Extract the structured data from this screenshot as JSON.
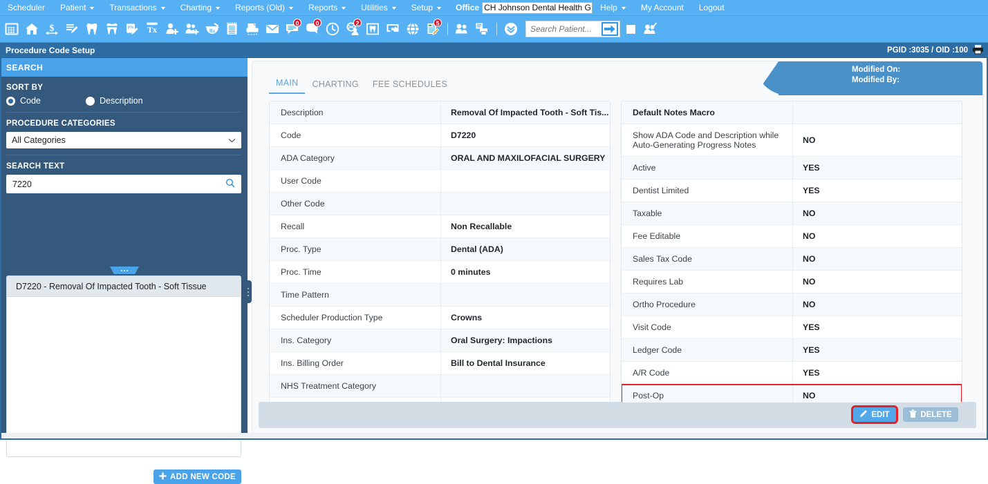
{
  "menubar": {
    "items": [
      {
        "label": "Scheduler",
        "caret": false
      },
      {
        "label": "Patient",
        "caret": true
      },
      {
        "label": "Transactions",
        "caret": true
      },
      {
        "label": "Charting",
        "caret": true
      },
      {
        "label": "Reports (Old)",
        "caret": true
      },
      {
        "label": "Reports",
        "caret": true
      },
      {
        "label": "Utilities",
        "caret": true
      },
      {
        "label": "Setup",
        "caret": true
      }
    ],
    "office_label": "Office",
    "office_value": "CH Johnson Dental Health Ger",
    "right_items": [
      {
        "label": "Help",
        "caret": true
      },
      {
        "label": "My Account",
        "caret": false
      },
      {
        "label": "Logout",
        "caret": false
      }
    ]
  },
  "toolbar": {
    "icons": [
      {
        "name": "calendar-icon",
        "badge": null
      },
      {
        "name": "home-icon",
        "badge": null
      },
      {
        "name": "dollar-transfer-icon",
        "badge": null
      },
      {
        "name": "treatment-plan-icon",
        "badge": null
      },
      {
        "name": "tooth-icon",
        "badge": null
      },
      {
        "name": "perio-tooth-icon",
        "badge": null
      },
      {
        "name": "progress-notes-icon",
        "badge": null
      },
      {
        "name": "tx-icon",
        "badge": null
      },
      {
        "name": "add-patient-icon",
        "badge": null
      },
      {
        "name": "add-family-icon",
        "badge": null
      },
      {
        "name": "prescription-icon",
        "badge": null
      },
      {
        "name": "notepad-icon",
        "badge": null
      },
      {
        "name": "print-icon",
        "badge": null
      },
      {
        "name": "envelope-icon",
        "badge": null
      },
      {
        "name": "message-icon",
        "badge": "0"
      },
      {
        "name": "chat-icon",
        "badge": "0"
      },
      {
        "name": "clock-icon",
        "badge": null
      },
      {
        "name": "patient-search-icon",
        "badge": "2"
      },
      {
        "name": "tooth-chart-icon",
        "badge": null
      },
      {
        "name": "screen-export-icon",
        "badge": null
      },
      {
        "name": "globe-icon",
        "badge": null
      },
      {
        "name": "edit-form-icon",
        "badge": "5"
      },
      {
        "name": "group-icon",
        "badge": null
      },
      {
        "name": "batch-print-icon",
        "badge": null
      },
      {
        "name": "double-chevron-down-icon",
        "badge": null
      }
    ],
    "search_placeholder": "Search Patient...",
    "go_icon": "arrow-right-icon",
    "checkbox_checked": false,
    "group-check-icon": "group-check-icon"
  },
  "pagebar": {
    "title": "Procedure Code Setup",
    "pgid": "PGID :3035  /  OID :100",
    "print_icon": "printer-icon"
  },
  "sidebar": {
    "search_header": "SEARCH",
    "sort_by_label": "SORT BY",
    "sort_options": [
      {
        "label": "Code",
        "selected": true
      },
      {
        "label": "Description",
        "selected": false
      }
    ],
    "categories_label": "PROCEDURE CATEGORIES",
    "categories_value": "All Categories",
    "search_text_label": "SEARCH TEXT",
    "search_text_value": "7220",
    "search_icon": "magnifier-icon",
    "results": [
      "D7220 - Removal Of Impacted Tooth - Soft Tissue"
    ],
    "add_new_code_label": "ADD NEW CODE"
  },
  "main": {
    "tabs": [
      {
        "label": "MAIN",
        "active": true
      },
      {
        "label": "CHARTING",
        "active": false
      },
      {
        "label": "FEE SCHEDULES",
        "active": false
      }
    ],
    "modified_on_label": "Modified On:",
    "modified_by_label": "Modified By:",
    "left_table": [
      {
        "key": "Description",
        "value": "Removal Of Impacted Tooth - Soft Tis...",
        "tall": false,
        "highlight": false
      },
      {
        "key": "Code",
        "value": "D7220",
        "tall": false,
        "highlight": false
      },
      {
        "key": "ADA Category",
        "value": "ORAL AND MAXILOFACIAL SURGERY",
        "tall": false,
        "highlight": false
      },
      {
        "key": "User Code",
        "value": "",
        "tall": false,
        "highlight": false
      },
      {
        "key": "Other Code",
        "value": "",
        "tall": false,
        "highlight": false
      },
      {
        "key": "Recall",
        "value": "Non Recallable",
        "tall": false,
        "highlight": false
      },
      {
        "key": "Proc. Type",
        "value": "Dental (ADA)",
        "tall": false,
        "highlight": false
      },
      {
        "key": "Proc. Time",
        "value": "0 minutes",
        "tall": false,
        "highlight": false
      },
      {
        "key": "Time Pattern",
        "value": "",
        "tall": false,
        "highlight": false
      },
      {
        "key": "Scheduler Production Type",
        "value": "Crowns",
        "tall": false,
        "highlight": false
      },
      {
        "key": "Ins. Category",
        "value": "Oral Surgery: Impactions",
        "tall": false,
        "highlight": false
      },
      {
        "key": "Ins. Billing Order",
        "value": "Bill to Dental Insurance",
        "tall": false,
        "highlight": false
      },
      {
        "key": "NHS Treatment Category",
        "value": "",
        "tall": false,
        "highlight": false
      },
      {
        "key": "",
        "value": "",
        "tall": false,
        "highlight": false
      }
    ],
    "right_table": [
      {
        "key": "Default Notes Macro",
        "value": "",
        "tall": false,
        "highlight": false,
        "header": true
      },
      {
        "key": "Show ADA Code and Description while Auto-Generating Progress Notes",
        "value": "NO",
        "tall": true,
        "highlight": false
      },
      {
        "key": "Active",
        "value": "YES",
        "tall": false,
        "highlight": false
      },
      {
        "key": "Dentist Limited",
        "value": "YES",
        "tall": false,
        "highlight": false
      },
      {
        "key": "Taxable",
        "value": "NO",
        "tall": false,
        "highlight": false
      },
      {
        "key": "Fee Editable",
        "value": "NO",
        "tall": false,
        "highlight": false
      },
      {
        "key": "Sales Tax Code",
        "value": "NO",
        "tall": false,
        "highlight": false
      },
      {
        "key": "Requires Lab",
        "value": "NO",
        "tall": false,
        "highlight": false
      },
      {
        "key": "Ortho Procedure",
        "value": "NO",
        "tall": false,
        "highlight": false
      },
      {
        "key": "Visit Code",
        "value": "YES",
        "tall": false,
        "highlight": false
      },
      {
        "key": "Ledger Code",
        "value": "YES",
        "tall": false,
        "highlight": false
      },
      {
        "key": "A/R Code",
        "value": "YES",
        "tall": false,
        "highlight": false
      },
      {
        "key": "Post-Op",
        "value": "NO",
        "tall": false,
        "highlight": true
      }
    ],
    "edit_label": "EDIT",
    "delete_label": "DELETE",
    "edit_icon": "pencil-icon",
    "delete_icon": "trash-icon"
  },
  "colors": {
    "menu_blue": "#56b0f4",
    "title_blue": "#2e6da4",
    "sidebar_blue": "#34597c",
    "accent_blue": "#4aa3e8",
    "highlight_red": "#e4202a",
    "badge_red": "#d80f2a"
  }
}
